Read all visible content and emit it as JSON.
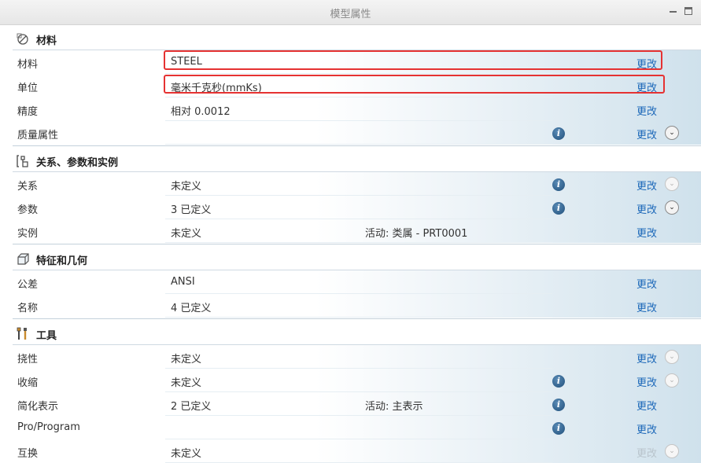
{
  "window": {
    "title": "模型属性",
    "minimize_icon": "minimize-icon",
    "maximize_icon": "maximize-icon"
  },
  "sections": [
    {
      "title": "材料",
      "icon": "material-icon",
      "rows": [
        {
          "label": "材料",
          "value": "STEEL",
          "value2": "",
          "help": false,
          "change": "更改",
          "change_enabled": true,
          "expand": "none"
        },
        {
          "label": "单位",
          "value": "毫米千克秒(mmKs)",
          "value2": "",
          "help": false,
          "change": "更改",
          "change_enabled": true,
          "expand": "none"
        },
        {
          "label": "精度",
          "value": "相对 0.0012",
          "value2": "",
          "help": false,
          "change": "更改",
          "change_enabled": true,
          "expand": "none"
        },
        {
          "label": "质量属性",
          "value": "",
          "value2": "",
          "help": true,
          "change": "更改",
          "change_enabled": true,
          "expand": "active"
        }
      ]
    },
    {
      "title": "关系、参数和实例",
      "icon": "relations-icon",
      "rows": [
        {
          "label": "关系",
          "value": "未定义",
          "value2": "",
          "help": true,
          "change": "更改",
          "change_enabled": true,
          "expand": "disabled"
        },
        {
          "label": "参数",
          "value": "3 已定义",
          "value2": "",
          "help": true,
          "change": "更改",
          "change_enabled": true,
          "expand": "active"
        },
        {
          "label": "实例",
          "value": "未定义",
          "value2": "活动: 类属 - PRT0001",
          "help": false,
          "change": "更改",
          "change_enabled": true,
          "expand": "none"
        }
      ]
    },
    {
      "title": "特征和几何",
      "icon": "feature-geometry-icon",
      "rows": [
        {
          "label": "公差",
          "value": "ANSI",
          "value2": "",
          "help": false,
          "change": "更改",
          "change_enabled": true,
          "expand": "none"
        },
        {
          "label": "名称",
          "value": "4 已定义",
          "value2": "",
          "help": false,
          "change": "更改",
          "change_enabled": true,
          "expand": "none"
        }
      ]
    },
    {
      "title": "工具",
      "icon": "tools-icon",
      "rows": [
        {
          "label": "挠性",
          "value": "未定义",
          "value2": "",
          "help": false,
          "change": "更改",
          "change_enabled": true,
          "expand": "disabled"
        },
        {
          "label": "收缩",
          "value": "未定义",
          "value2": "",
          "help": true,
          "change": "更改",
          "change_enabled": true,
          "expand": "disabled"
        },
        {
          "label": "简化表示",
          "value": "2 已定义",
          "value2": "活动: 主表示",
          "help": true,
          "change": "更改",
          "change_enabled": true,
          "expand": "none"
        },
        {
          "label": "Pro/Program",
          "value": "",
          "value2": "",
          "help": true,
          "change": "更改",
          "change_enabled": true,
          "expand": "none"
        },
        {
          "label": "互换",
          "value": "未定义",
          "value2": "",
          "help": false,
          "change": "更改",
          "change_enabled": false,
          "expand": "disabled"
        }
      ]
    }
  ],
  "colors": {
    "link": "#1c68b9",
    "highlight": "#e53232",
    "disabled": "#b9c4cc"
  }
}
